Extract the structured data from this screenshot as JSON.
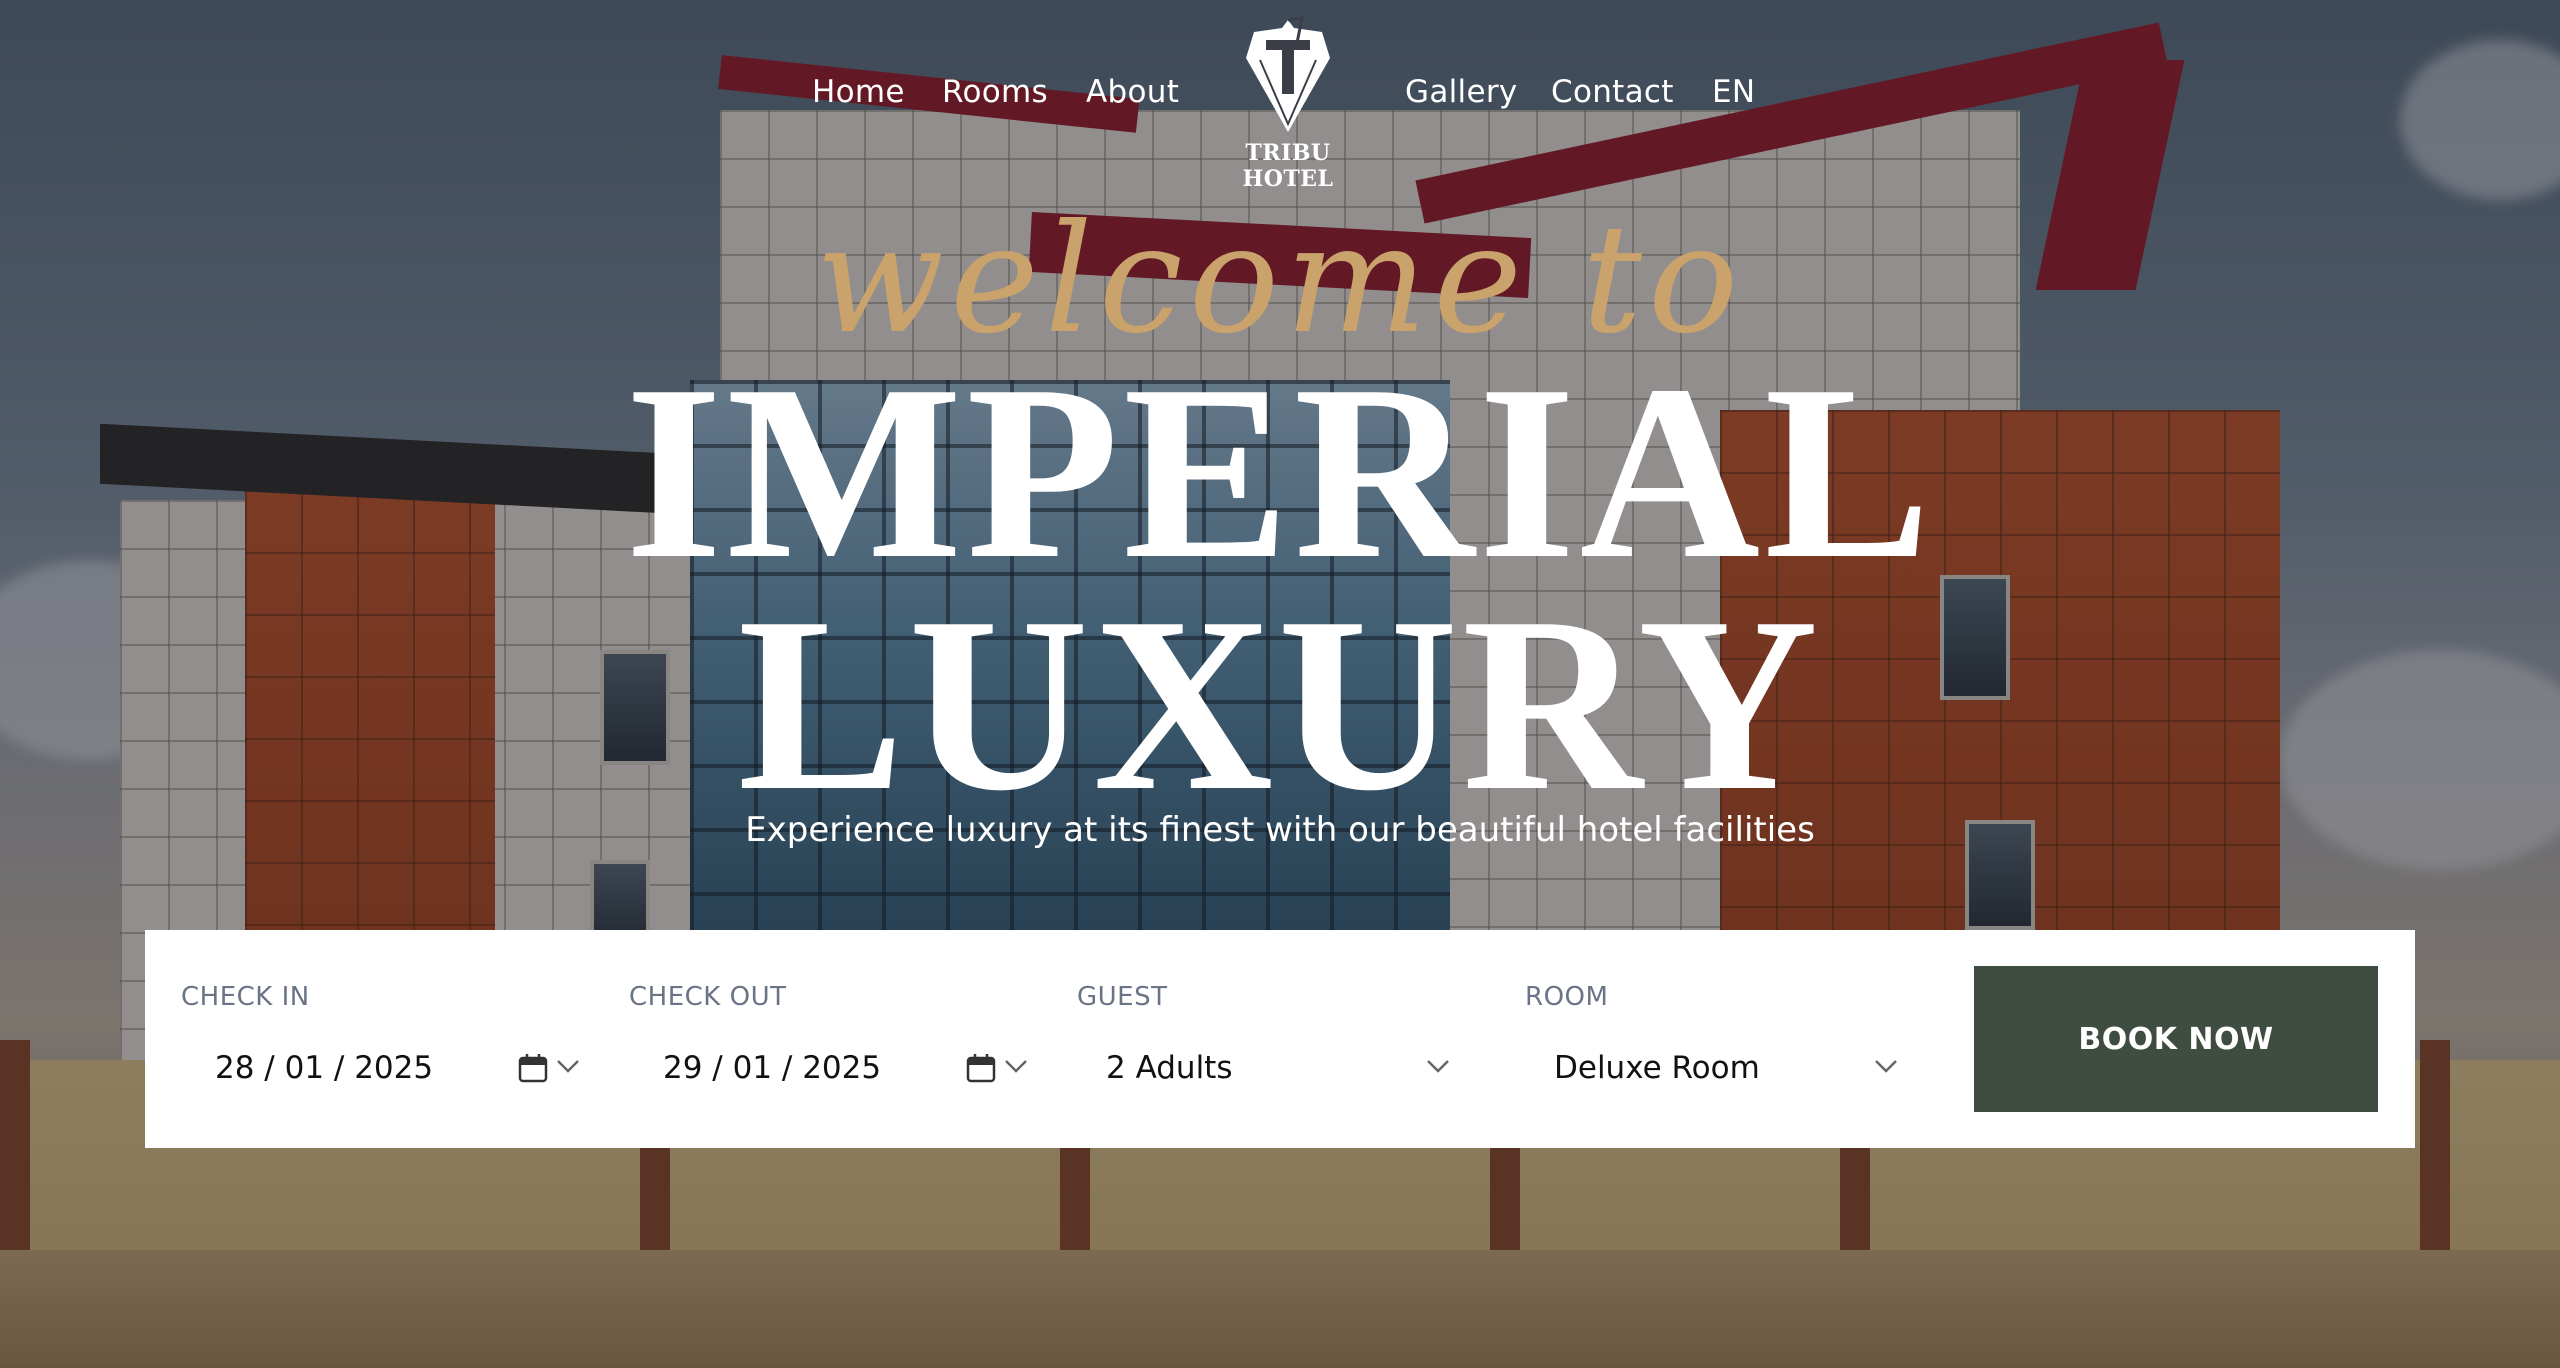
{
  "nav": {
    "left": [
      "Home",
      "Rooms",
      "About"
    ],
    "right": [
      "Gallery",
      "Contact",
      "EN"
    ]
  },
  "logo": {
    "text": "TRIBU HOTEL",
    "icon": "tribu-hotel-logo-icon"
  },
  "hero": {
    "welcome": "welcome to",
    "title_line1": "IMPERIAL",
    "title_line2": "LUXURY",
    "subtitle": "Experience luxury at its finest with our beautiful hotel facilities"
  },
  "booking": {
    "check_in": {
      "label": "CHECK IN",
      "value": "28 / 01 / 2025"
    },
    "check_out": {
      "label": "CHECK OUT",
      "value": "29 / 01 / 2025"
    },
    "guest": {
      "label": "GUEST",
      "value": "2 Adults"
    },
    "room": {
      "label": "ROOM",
      "value": "Deluxe Room"
    },
    "button": "BOOK NOW"
  },
  "colors": {
    "accent_gold": "#c9a36b",
    "button_green": "#3f4c40",
    "label_gray": "#6b7486"
  }
}
